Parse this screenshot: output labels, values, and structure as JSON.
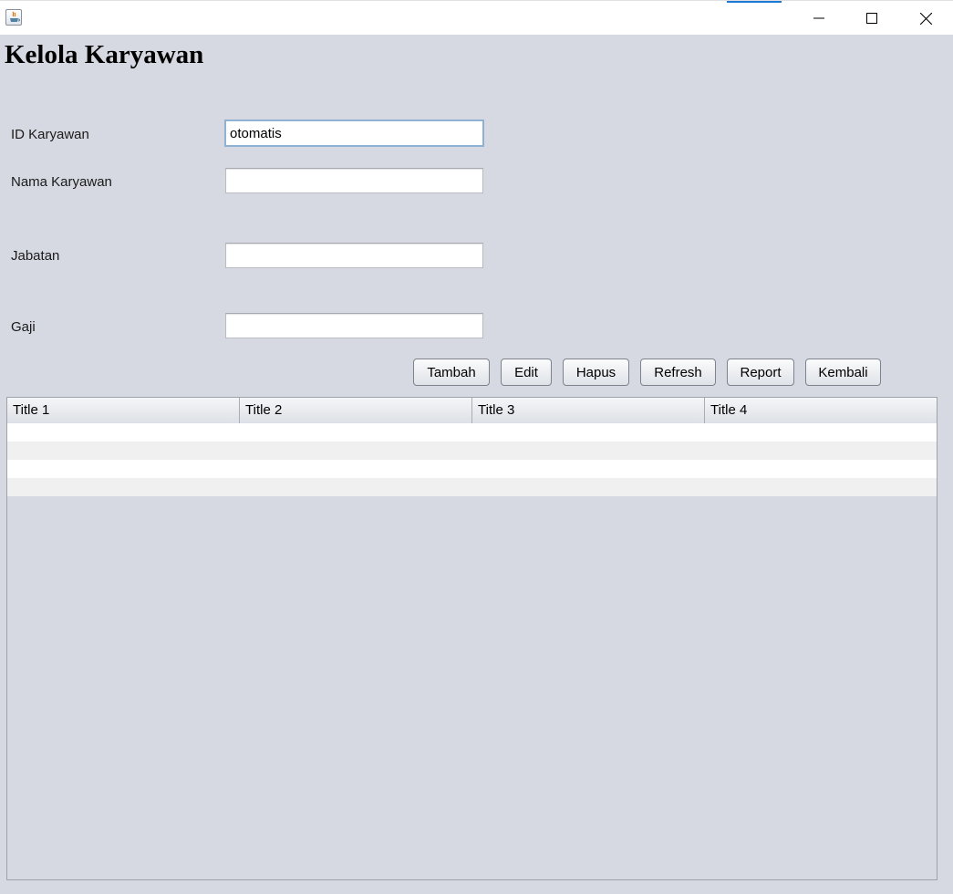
{
  "window": {
    "controls": [
      "minimize-icon",
      "maximize-icon",
      "close-icon"
    ]
  },
  "page": {
    "title": "Kelola Karyawan"
  },
  "form": {
    "id_label": "ID Karyawan",
    "id_value": "otomatis",
    "nama_label": "Nama Karyawan",
    "nama_value": "",
    "jabatan_label": "Jabatan",
    "jabatan_value": "",
    "gaji_label": "Gaji",
    "gaji_value": ""
  },
  "buttons": {
    "tambah": "Tambah",
    "edit": "Edit",
    "hapus": "Hapus",
    "refresh": "Refresh",
    "report": "Report",
    "kembali": "Kembali"
  },
  "table": {
    "columns": [
      "Title 1",
      "Title 2",
      "Title 3",
      "Title 4"
    ],
    "rows": [
      [
        "",
        "",
        "",
        ""
      ],
      [
        "",
        "",
        "",
        ""
      ],
      [
        "",
        "",
        "",
        ""
      ],
      [
        "",
        "",
        "",
        ""
      ]
    ]
  }
}
